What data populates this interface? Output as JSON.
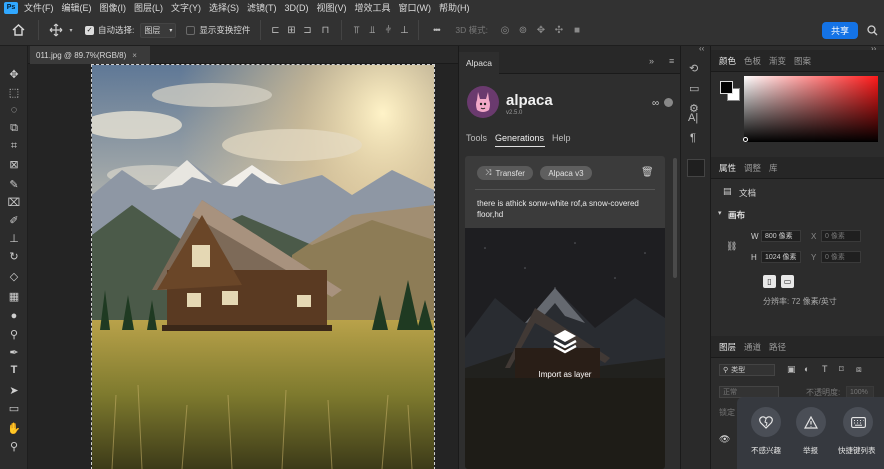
{
  "app": {
    "logo_text": "Ps"
  },
  "menu": [
    "文件(F)",
    "编辑(E)",
    "图像(I)",
    "图层(L)",
    "文字(Y)",
    "选择(S)",
    "滤镜(T)",
    "3D(D)",
    "视图(V)",
    "增效工具",
    "窗口(W)",
    "帮助(H)"
  ],
  "options": {
    "auto_select_label": "自动选择:",
    "auto_select_value": "图层",
    "show_transform_label": "显示变换控件",
    "mode_3d_label": "3D 模式:",
    "more_label": "•••",
    "share_label": "共享"
  },
  "document": {
    "tab_title": "011.jpg @ 89.7%(RGB/8)",
    "tab_close": "×"
  },
  "alpaca": {
    "panel_tab": "Alpaca",
    "name": "alpaca",
    "version": "v2.5.0",
    "tabs": [
      "Tools",
      "Generations",
      "Help"
    ],
    "active_tab": "Generations",
    "card": {
      "transfer_label": "Transfer",
      "model_label": "Alpaca v3",
      "prompt": "there is athick sonw-white rof,a snow-covered floor,hd",
      "import_label": "Import as layer"
    }
  },
  "right": {
    "color_tabs": [
      "颜色",
      "色板",
      "渐变",
      "图案"
    ],
    "prop_tabs": [
      "属性",
      "调整",
      "库"
    ],
    "doc_label": "文档",
    "canvas_section": "画布",
    "w_label": "W",
    "w_value": "800 像素",
    "x_label": "X",
    "x_value": "0 像素",
    "h_label": "H",
    "h_value": "1024 像素",
    "y_label": "Y",
    "y_value": "0 像素",
    "resolution": "分辨率: 72 像素/英寸",
    "layer_tabs": [
      "图层",
      "通道",
      "路径"
    ],
    "filter_kind": "类型",
    "blend_mode": "正常",
    "opacity_label": "不透明度:",
    "opacity_value": "100%",
    "lock_label": "锁定"
  },
  "overlay": {
    "items": [
      "不感兴趣",
      "举报",
      "快捷键列表"
    ]
  },
  "colors": {
    "accent": "#1473e6",
    "fg": "#000000",
    "bg": "#ffffff"
  }
}
